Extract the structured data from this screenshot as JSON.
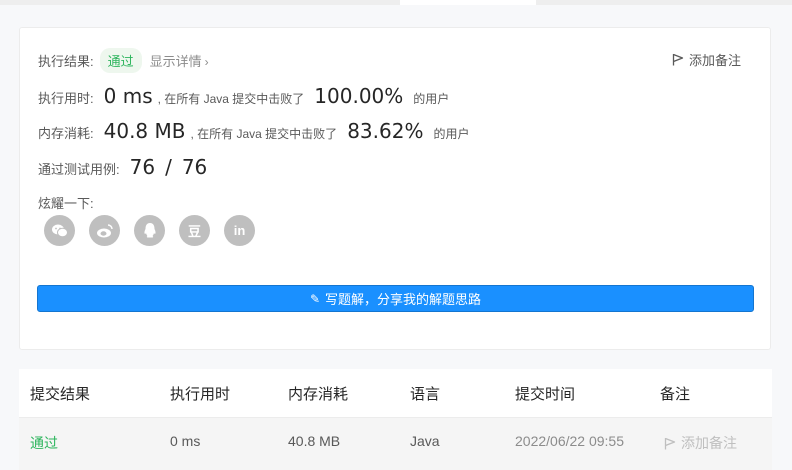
{
  "result": {
    "status_label": "执行结果:",
    "status": "通过",
    "detail_link": "显示详情",
    "add_note": "添加备注"
  },
  "runtime": {
    "label": "执行用时:",
    "value": "0 ms",
    "mid_text": ", 在所有 Java 提交中击败了",
    "percent": "100.00%",
    "suffix": "的用户"
  },
  "memory": {
    "label": "内存消耗:",
    "value": "40.8 MB",
    "mid_text": ", 在所有 Java 提交中击败了",
    "percent": "83.62%",
    "suffix": "的用户"
  },
  "testcases": {
    "label": "通过测试用例:",
    "passed": "76",
    "sep": "/",
    "total": "76"
  },
  "share": {
    "label": "炫耀一下:",
    "icons": [
      "wechat-icon",
      "weibo-icon",
      "qq-icon",
      "douban-icon",
      "linkedin-icon"
    ],
    "douban_glyph": "豆",
    "linkedin_glyph": "in"
  },
  "write_solution": "写题解，分享我的解题思路",
  "table": {
    "headers": [
      "提交结果",
      "执行用时",
      "内存消耗",
      "语言",
      "提交时间",
      "备注"
    ],
    "rows": [
      {
        "result": "通过",
        "runtime": "0 ms",
        "memory": "40.8 MB",
        "language": "Java",
        "time": "2022/06/22 09:55",
        "note": "添加备注"
      }
    ]
  },
  "colors": {
    "accent": "#1a90ff",
    "pass": "#2db55d",
    "icon_gray": "#bfbfbf"
  }
}
